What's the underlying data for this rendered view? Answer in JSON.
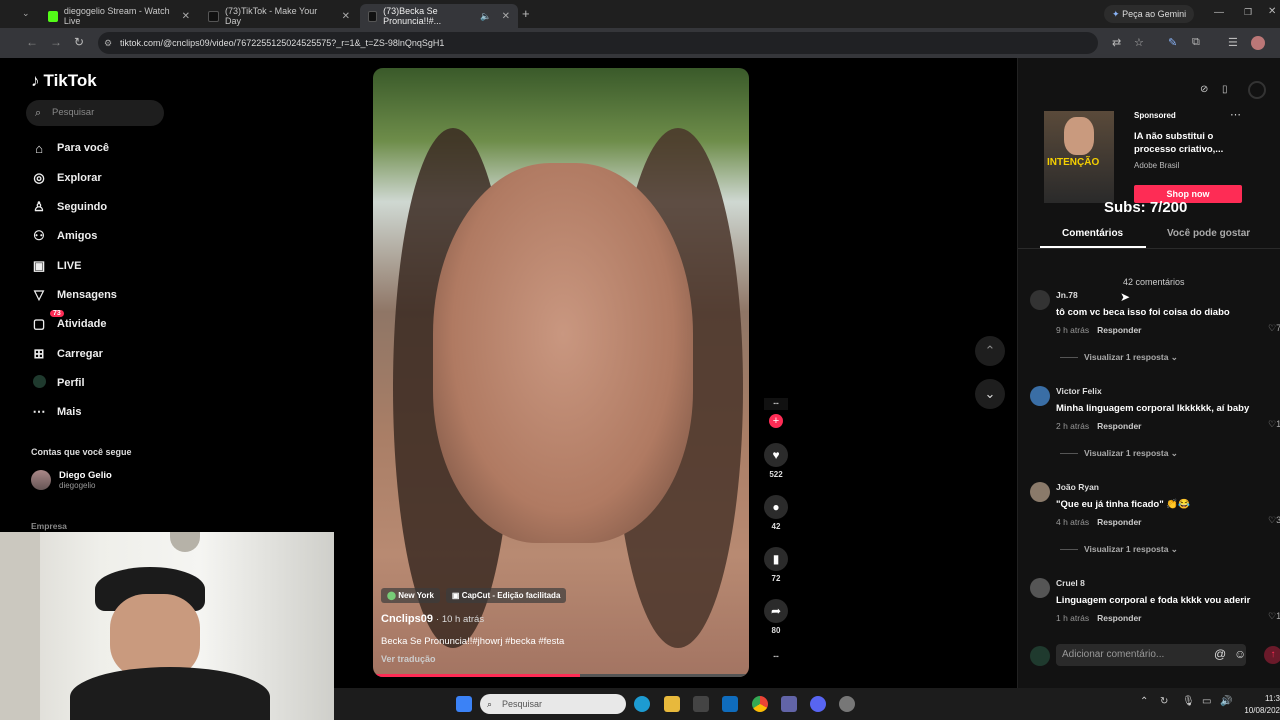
{
  "browser": {
    "tabs": [
      {
        "label": "diegogelio Stream - Watch Live"
      },
      {
        "label": "(73)TikTok - Make Your Day"
      },
      {
        "label": "(73)Becka Se Pronuncia!!#..."
      }
    ],
    "gemini_label": "Peça ao Gemini",
    "url": "tiktok.com/@cnclips09/video/7672255125024525575?_r=1&_t=ZS-98lnQnqSgH1"
  },
  "sidebar": {
    "logo": "TikTok",
    "search_placeholder": "Pesquisar",
    "items": [
      {
        "label": "Para você",
        "icon": "home-icon"
      },
      {
        "label": "Explorar",
        "icon": "compass-icon"
      },
      {
        "label": "Seguindo",
        "icon": "following-icon"
      },
      {
        "label": "Amigos",
        "icon": "friends-icon"
      },
      {
        "label": "LIVE",
        "icon": "live-icon"
      },
      {
        "label": "Mensagens",
        "icon": "messages-icon"
      },
      {
        "label": "Atividade",
        "icon": "activity-icon",
        "badge": "73"
      },
      {
        "label": "Carregar",
        "icon": "upload-icon"
      },
      {
        "label": "Perfil",
        "icon": "profile-icon"
      },
      {
        "label": "Mais",
        "icon": "more-icon"
      }
    ],
    "following_title": "Contas que você segue",
    "following": {
      "name": "Diego Gelio",
      "user": "diegogelio"
    },
    "empresa": "Empresa"
  },
  "video": {
    "tags": [
      "New York",
      "CapCut - Edição facilitada"
    ],
    "author": "Cnclips09",
    "time": "· 10 h atrás",
    "description": "Becka Se Pronuncia!!#jhowrj #becka #festa",
    "translate": "Ver tradução",
    "progress": 0.55
  },
  "actions": {
    "likes": "522",
    "comments": "42",
    "saves": "72",
    "shares": "80"
  },
  "right": {
    "sponsored_label": "Sponsored",
    "sponsored_image_text": "INTENÇÃO",
    "sponsored_title": "IA não substitui o processo criativo,...",
    "sponsored_brand": "Adobe Brasil",
    "shop_label": "Shop now",
    "subs": "Subs: 7/200",
    "tab_comments": "Comentários",
    "tab_like": "Você pode gostar",
    "comment_count": "42 comentários",
    "reply_label": "Responder",
    "comments": [
      {
        "name": "Jn.78",
        "text": "tô com vc beca isso foi coisa do diabo",
        "time": "9 h atrás",
        "replies": "Visualizar 1 resposta",
        "likes": "7"
      },
      {
        "name": "Victor Felix",
        "text": "Minha linguagem corporal Ikkkkkk, aí baby",
        "time": "2 h atrás",
        "replies": "Visualizar 1 resposta",
        "likes": "1"
      },
      {
        "name": "João Ryan",
        "text": "\"Que eu já tinha ficado\" 👏😂",
        "time": "4 h atrás",
        "replies": "Visualizar 1 resposta",
        "likes": "3"
      },
      {
        "name": "Cruel 8",
        "text": "Linguagem corporal e foda kkkk vou aderir",
        "time": "1 h atrás",
        "replies": "",
        "likes": "1"
      }
    ],
    "add_comment_placeholder": "Adicionar comentário..."
  },
  "taskbar": {
    "search_placeholder": "Pesquisar",
    "time": "11:3",
    "date": "10/08/202"
  }
}
